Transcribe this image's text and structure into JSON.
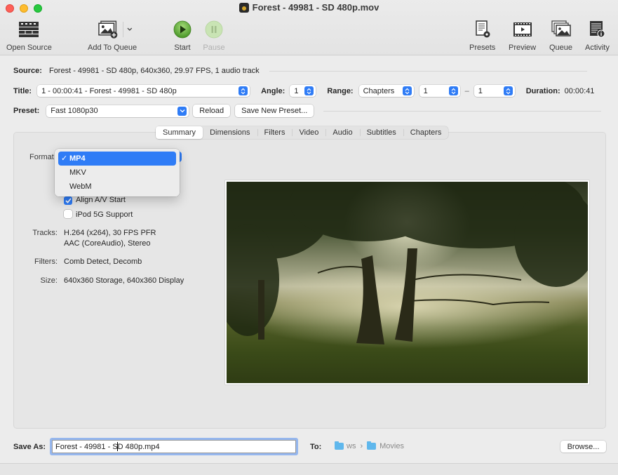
{
  "window": {
    "title": "Forest - 49981 - SD 480p.mov"
  },
  "toolbar": {
    "open_source": "Open Source",
    "add_to_queue": "Add To Queue",
    "start": "Start",
    "pause": "Pause",
    "presets": "Presets",
    "preview": "Preview",
    "queue": "Queue",
    "activity": "Activity"
  },
  "source": {
    "label": "Source:",
    "value": "Forest - 49981 - SD 480p, 640x360, 29.97 FPS, 1 audio track"
  },
  "title_row": {
    "title_label": "Title:",
    "title_value": "1 - 00:00:41 - Forest - 49981 - SD 480p",
    "angle_label": "Angle:",
    "angle_value": "1",
    "range_label": "Range:",
    "range_mode": "Chapters",
    "range_start": "1",
    "range_sep": "–",
    "range_end": "1",
    "duration_label": "Duration:",
    "duration_value": "00:00:41"
  },
  "preset_row": {
    "label": "Preset:",
    "value": "Fast 1080p30",
    "reload": "Reload",
    "save_new": "Save New Preset..."
  },
  "tabs": [
    {
      "label": "Summary",
      "active": true
    },
    {
      "label": "Dimensions",
      "active": false
    },
    {
      "label": "Filters",
      "active": false
    },
    {
      "label": "Video",
      "active": false
    },
    {
      "label": "Audio",
      "active": false
    },
    {
      "label": "Subtitles",
      "active": false
    },
    {
      "label": "Chapters",
      "active": false
    }
  ],
  "summary": {
    "format_label": "Format",
    "format_menu": [
      {
        "label": "MP4",
        "selected": true
      },
      {
        "label": "MKV",
        "selected": false
      },
      {
        "label": "WebM",
        "selected": false
      }
    ],
    "check_mark": "✓",
    "align_av": {
      "label": "Align A/V Start",
      "checked": true
    },
    "ipod": {
      "label": "iPod 5G Support",
      "checked": false
    },
    "tracks_label": "Tracks:",
    "tracks_line1": "H.264 (x264), 30 FPS PFR",
    "tracks_line2": "AAC (CoreAudio), Stereo",
    "filters_label": "Filters:",
    "filters_value": "Comb Detect, Decomb",
    "size_label": "Size:",
    "size_value": "640x360 Storage, 640x360 Display"
  },
  "save": {
    "label": "Save As:",
    "value_before_caret": "Forest - 49981 - S",
    "value_after_caret": "D 480p.mp4",
    "to_label": "To:",
    "path": [
      "ws",
      "Movies"
    ],
    "path_sep": "›",
    "browse": "Browse..."
  },
  "colors": {
    "accent": "#2f7cf6",
    "start_green": "#5da93a"
  }
}
